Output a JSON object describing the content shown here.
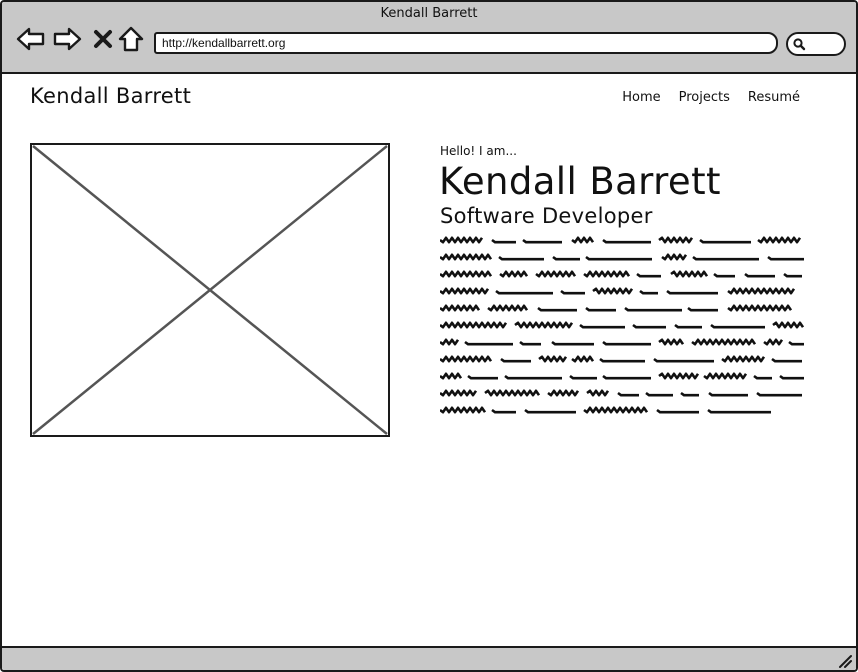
{
  "browser": {
    "window_title": "Kendall Barrett",
    "url": "http://kendallbarrett.org",
    "icons": [
      "back-arrow-icon",
      "forward-arrow-icon",
      "stop-x-icon",
      "home-icon",
      "search-icon",
      "resize-grip-icon"
    ]
  },
  "site": {
    "title": "Kendall Barrett",
    "nav": [
      "Home",
      "Projects",
      "Resumé"
    ]
  },
  "hero": {
    "greeting": "Hello! I am...",
    "name": "Kendall Barrett",
    "role": "Software Developer"
  },
  "colors": {
    "chrome": "#c8c8c8",
    "stroke": "#1a1a1a",
    "placeholder_line": "#555555"
  }
}
